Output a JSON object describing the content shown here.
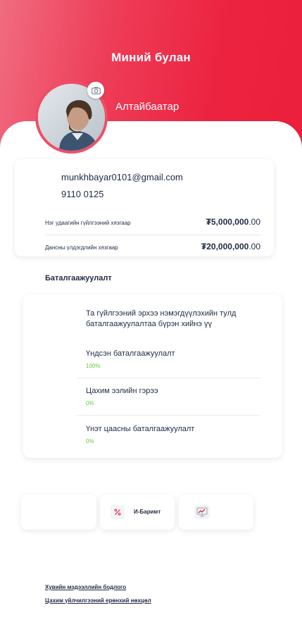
{
  "header": {
    "title": "Миний булан",
    "gradient_start": "#f06c80",
    "gradient_end": "#eb1f3b"
  },
  "profile": {
    "name": "Алтайбаатар",
    "avatar_icon": "user-photo",
    "camera_icon": "camera-icon"
  },
  "contact": {
    "email": "munkhbayar0101@gmail.com",
    "phone": "9110 0125"
  },
  "limits": [
    {
      "label": "Нэг удаагийн гүйлгээний хязгаар",
      "amount": "₮5,000,000",
      "decimals": ".00"
    },
    {
      "label": "Дансны үлдэгдлийн хязгаар",
      "amount": "₮20,000,000",
      "decimals": ".00"
    }
  ],
  "verification": {
    "section_title": "Баталгаажуулалт",
    "note": "Та гүйлгээний эрхээ нэмэгдүүлэхийн тулд баталгаажуулалтаа бүрэн хийнэ үү",
    "items": [
      {
        "label": "Үндсэн баталгаажуулалт",
        "percent": "100%"
      },
      {
        "label": "Цахим ээлийн гэрээ",
        "percent": "0%"
      },
      {
        "label": "Үнэт цаасны баталгаажуулалт",
        "percent": "0%"
      }
    ],
    "percent_color": "#67c93a"
  },
  "actions": [
    {
      "label": "",
      "icon": "blank"
    },
    {
      "label": "И-Баримт",
      "icon": "percent-icon"
    },
    {
      "label": "",
      "icon": "chart-monitor-icon"
    }
  ],
  "footer": {
    "privacy_link": "Хувийн мэдээллийн бодлого",
    "terms_link": "Цахим үйлчилгээний ерөнхий нөхцөл"
  },
  "accent_color": "#eb1f3b"
}
